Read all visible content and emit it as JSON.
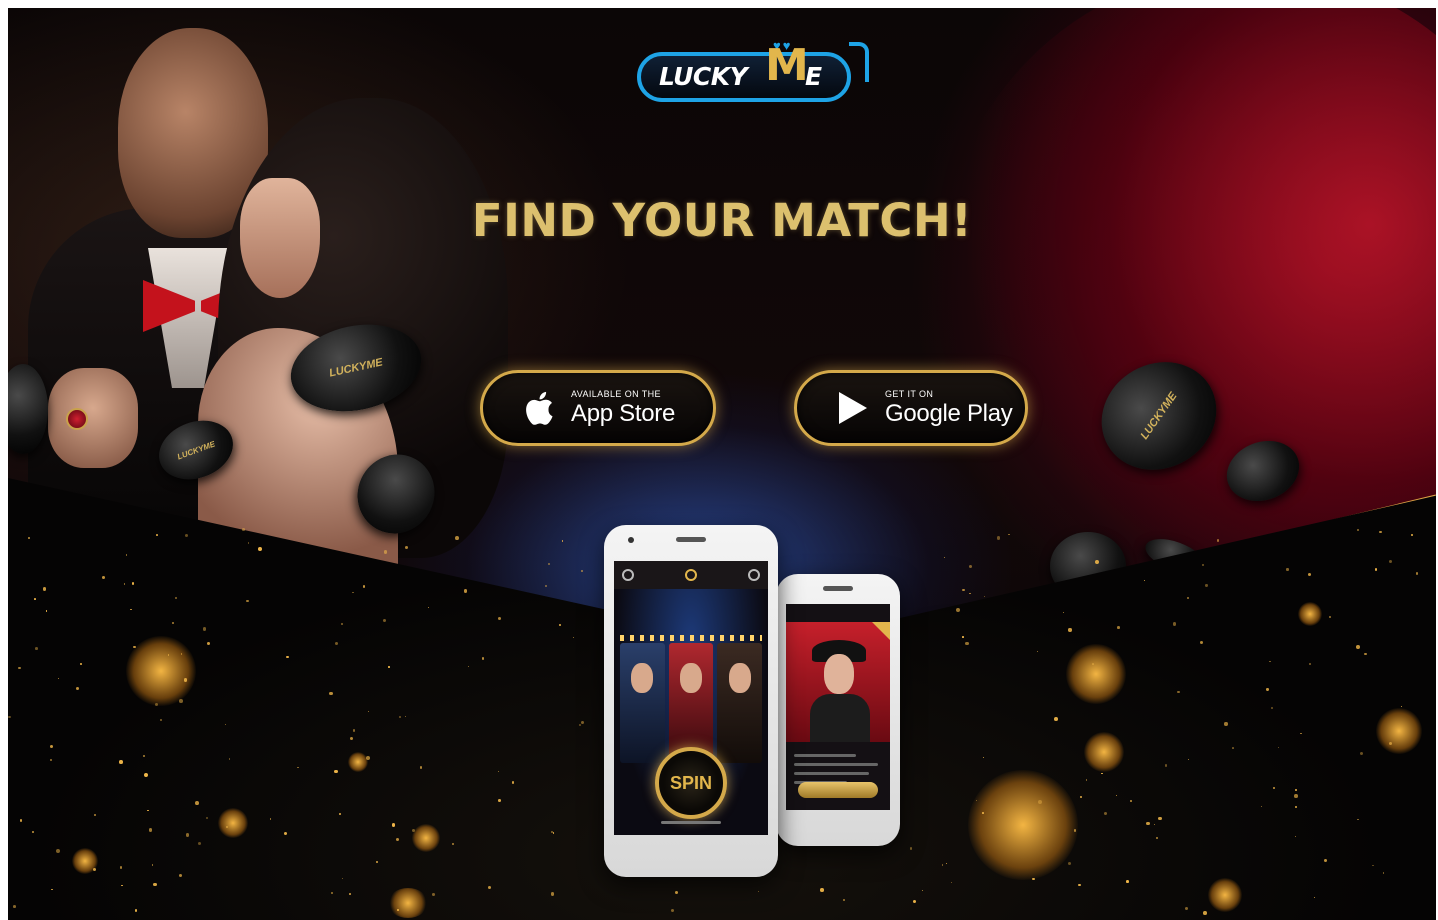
{
  "brand": {
    "logo_text": "LUCKY",
    "logo_m": "M",
    "logo_e": "E",
    "logo_hearts": "♥♥",
    "colors": {
      "gold": "#dcc06e",
      "blue": "#1ea3e6",
      "red": "#c4121c"
    }
  },
  "hero": {
    "headline": "FIND YOUR MATCH!"
  },
  "store_buttons": {
    "app_store": {
      "small": "AVAILABLE ON THE",
      "big": "App Store",
      "icon": "apple-icon"
    },
    "google_play": {
      "small": "GET IT ON",
      "big": "Google Play",
      "icon": "play-icon"
    }
  },
  "phone_app": {
    "spin_label": "SPIN"
  },
  "tokens": {
    "label": "LUCKYME"
  }
}
